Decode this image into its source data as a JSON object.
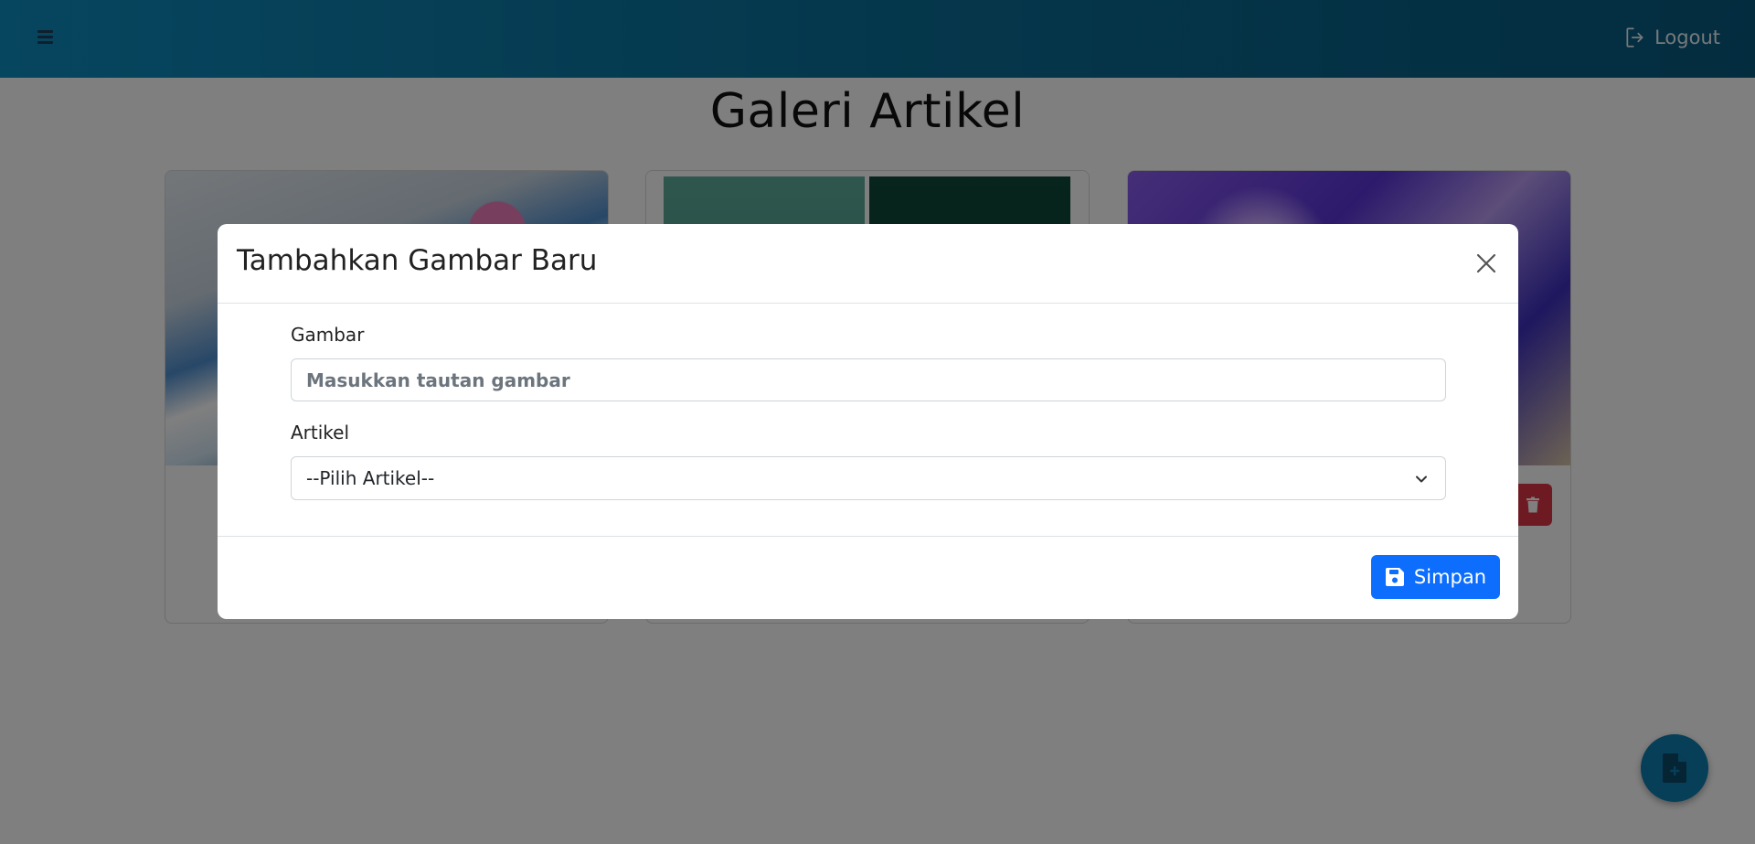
{
  "header": {
    "logout_label": "Logout"
  },
  "page": {
    "title": "Galeri Artikel"
  },
  "modal": {
    "title": "Tambahkan Gambar Baru",
    "image_label": "Gambar",
    "image_placeholder": "Masukkan tautan gambar",
    "image_value": "",
    "article_label": "Artikel",
    "article_selected": "--Pilih Artikel--",
    "save_label": "Simpan"
  },
  "icons": {
    "menu": "hamburger-icon",
    "logout": "logout-icon",
    "close": "close-icon",
    "chevron": "chevron-down-icon",
    "save": "floppy-disk-icon",
    "delete": "trash-icon",
    "fab": "add-document-icon"
  },
  "colors": {
    "topbar": "#0a6f98",
    "primary_button": "#0d6efd",
    "danger_button": "#dc3545",
    "fab": "#0c7fae"
  }
}
